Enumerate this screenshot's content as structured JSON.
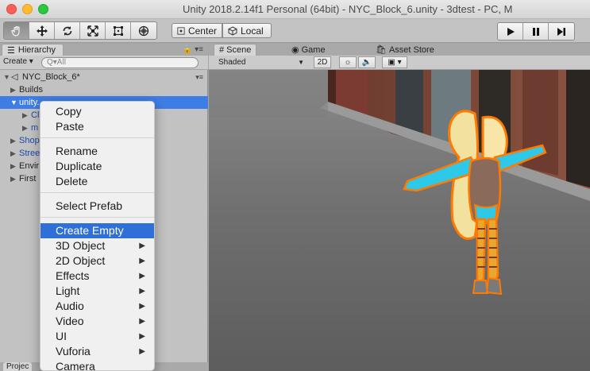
{
  "window": {
    "title": "Unity 2018.2.14f1 Personal (64bit) - NYC_Block_6.unity - 3dtest - PC, M"
  },
  "toolbar": {
    "tools": [
      "hand-tool",
      "move-tool",
      "rotate-tool",
      "scale-tool",
      "rect-tool",
      "transform-tool"
    ],
    "pivot_label": "Center",
    "space_label": "Local",
    "play_buttons": [
      "play",
      "pause",
      "step"
    ]
  },
  "hierarchy": {
    "tab_label": "Hierarchy",
    "create_label": "Create",
    "search_placeholder": "Q▾All",
    "scene_name": "NYC_Block_6*",
    "items": [
      {
        "label": "Builds"
      },
      {
        "label": "unity..."
      },
      {
        "label": "Cl"
      },
      {
        "label": "m"
      },
      {
        "label": "Shop"
      },
      {
        "label": "Stree"
      },
      {
        "label": "Envir"
      },
      {
        "label": "First"
      }
    ],
    "bottom_tab": "Projec"
  },
  "scene_view": {
    "tabs": [
      "Scene",
      "Game",
      "Asset Store"
    ],
    "shading_mode": "Shaded",
    "mode_2d": "2D"
  },
  "context_menu": {
    "items": [
      {
        "label": "Copy"
      },
      {
        "label": "Paste"
      },
      {
        "label": "Rename"
      },
      {
        "label": "Duplicate"
      },
      {
        "label": "Delete"
      },
      {
        "label": "Select Prefab"
      },
      {
        "label": "Create Empty"
      },
      {
        "label": "3D Object"
      },
      {
        "label": "2D Object"
      },
      {
        "label": "Effects"
      },
      {
        "label": "Light"
      },
      {
        "label": "Audio"
      },
      {
        "label": "Video"
      },
      {
        "label": "UI"
      },
      {
        "label": "Vuforia"
      },
      {
        "label": "Camera"
      }
    ]
  }
}
